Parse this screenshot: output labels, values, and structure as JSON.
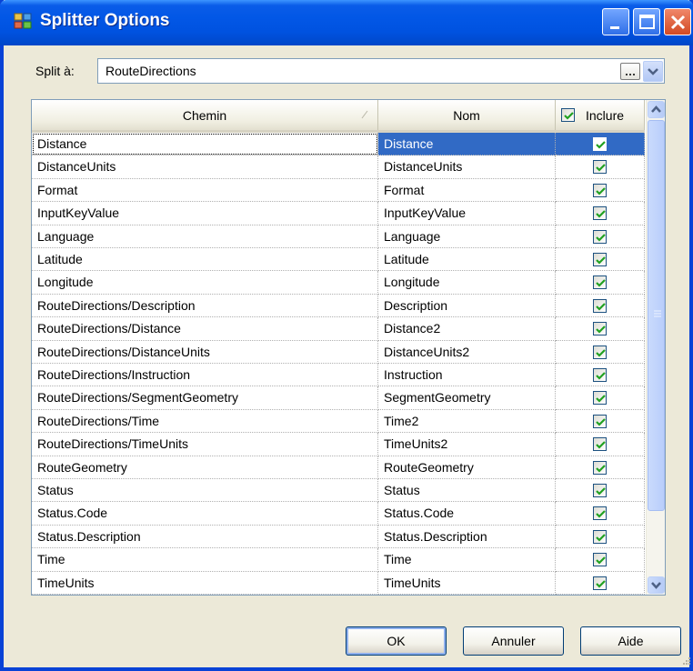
{
  "window": {
    "title": "Splitter Options"
  },
  "split": {
    "label": "Split à:",
    "value": "RouteDirections"
  },
  "grid": {
    "columns": {
      "path": "Chemin",
      "name": "Nom",
      "include": "Inclure"
    },
    "rows": [
      {
        "path": "Distance",
        "name": "Distance",
        "included": true,
        "selected": true
      },
      {
        "path": "DistanceUnits",
        "name": "DistanceUnits",
        "included": true
      },
      {
        "path": "Format",
        "name": "Format",
        "included": true
      },
      {
        "path": "InputKeyValue",
        "name": "InputKeyValue",
        "included": true
      },
      {
        "path": "Language",
        "name": "Language",
        "included": true
      },
      {
        "path": "Latitude",
        "name": "Latitude",
        "included": true
      },
      {
        "path": "Longitude",
        "name": "Longitude",
        "included": true
      },
      {
        "path": "RouteDirections/Description",
        "name": "Description",
        "included": true
      },
      {
        "path": "RouteDirections/Distance",
        "name": "Distance2",
        "included": true
      },
      {
        "path": "RouteDirections/DistanceUnits",
        "name": "DistanceUnits2",
        "included": true
      },
      {
        "path": "RouteDirections/Instruction",
        "name": "Instruction",
        "included": true
      },
      {
        "path": "RouteDirections/SegmentGeometry",
        "name": "SegmentGeometry",
        "included": true
      },
      {
        "path": "RouteDirections/Time",
        "name": "Time2",
        "included": true
      },
      {
        "path": "RouteDirections/TimeUnits",
        "name": "TimeUnits2",
        "included": true
      },
      {
        "path": "RouteGeometry",
        "name": "RouteGeometry",
        "included": true
      },
      {
        "path": "Status",
        "name": "Status",
        "included": true
      },
      {
        "path": "Status.Code",
        "name": "Status.Code",
        "included": true
      },
      {
        "path": "Status.Description",
        "name": "Status.Description",
        "included": true
      },
      {
        "path": "Time",
        "name": "Time",
        "included": true
      },
      {
        "path": "TimeUnits",
        "name": "TimeUnits",
        "included": true
      }
    ]
  },
  "buttons": {
    "ok": "OK",
    "cancel": "Annuler",
    "help": "Aide"
  },
  "colors": {
    "titlebar": "#0052e0",
    "selection": "#316ac5",
    "check": "#21a121",
    "dialog_bg": "#ece9d8"
  },
  "icons": {
    "app": "splitter-app-icon",
    "minimize": "minimize-icon",
    "maximize": "maximize-icon",
    "close": "close-icon",
    "browse": "ellipsis-icon",
    "dropdown": "chevron-down-icon",
    "sort": "sort-indicator-icon",
    "scroll_up": "chevron-up-icon",
    "scroll_down": "chevron-down-icon"
  }
}
